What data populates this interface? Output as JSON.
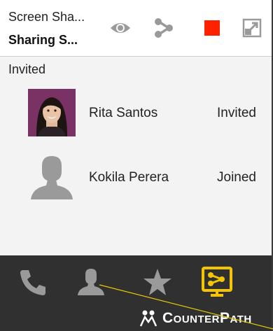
{
  "header": {
    "title": "Screen Sha...",
    "subtitle": "Sharing S...",
    "icons": [
      "eye-icon",
      "share-icon",
      "stop-icon",
      "popout-icon"
    ],
    "stop_color": "#ff2200"
  },
  "participants": {
    "section_label": "Invited",
    "items": [
      {
        "name": "Rita Santos",
        "status": "Invited",
        "avatar": "photo"
      },
      {
        "name": "Kokila Perera",
        "status": "Joined",
        "avatar": "silhouette-icon"
      }
    ]
  },
  "nav": {
    "items": [
      "phone-icon",
      "contacts-icon",
      "favorites-icon",
      "screen-share-icon"
    ],
    "active_color": "#f5c400",
    "brand": "CounterPath"
  }
}
